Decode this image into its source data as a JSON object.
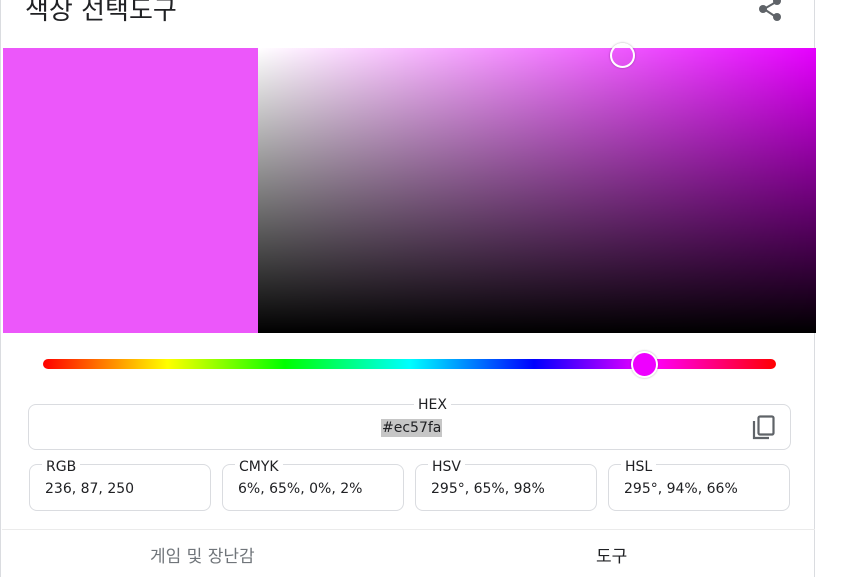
{
  "header": {
    "title": "색상 선택도구",
    "share_icon": "share-icon"
  },
  "colors": {
    "selected": "#ec57fa",
    "hue_base": "#e600ff",
    "hue_handle": "#ee00ff"
  },
  "picker": {
    "hue_degrees": 295,
    "saturation_percent": 65,
    "value_percent": 98
  },
  "hex": {
    "label": "HEX",
    "value": "#ec57fa",
    "copy_icon": "copy-icon"
  },
  "rgb": {
    "label": "RGB",
    "value": "236, 87, 250"
  },
  "cmyk": {
    "label": "CMYK",
    "value": "6%, 65%, 0%, 2%"
  },
  "hsv": {
    "label": "HSV",
    "value": "295°, 65%, 98%"
  },
  "hsl": {
    "label": "HSL",
    "value": "295°, 94%, 66%"
  },
  "tabs": [
    {
      "label": "게임 및 장난감",
      "active": false
    },
    {
      "label": "도구",
      "active": true
    }
  ]
}
